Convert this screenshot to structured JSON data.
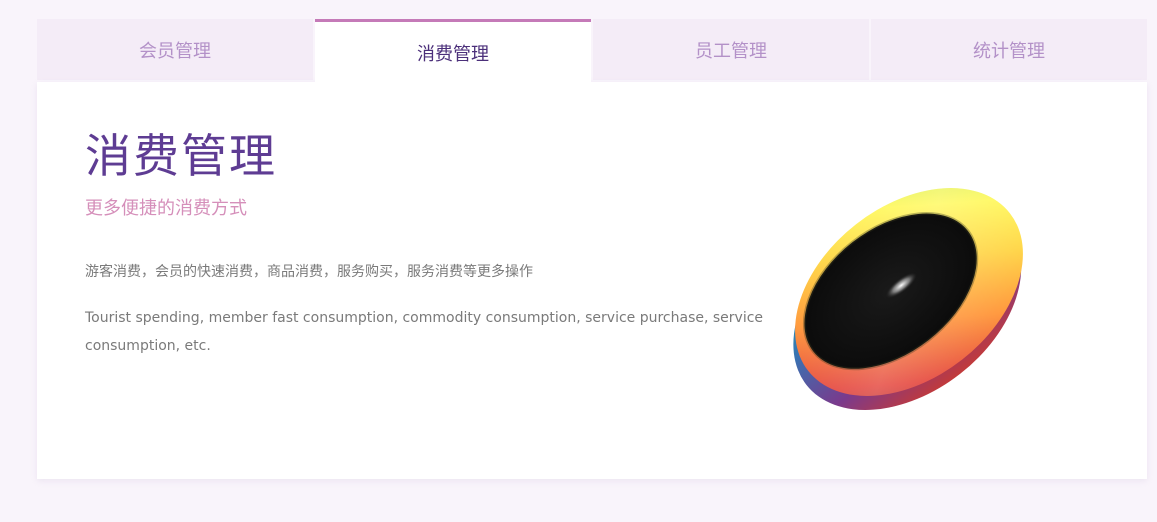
{
  "tabs": [
    {
      "label": "会员管理",
      "active": false
    },
    {
      "label": "消费管理",
      "active": true
    },
    {
      "label": "员工管理",
      "active": false
    },
    {
      "label": "统计管理",
      "active": false
    }
  ],
  "panel": {
    "title": "消费管理",
    "subtitle": "更多便捷的消费方式",
    "description_cn": "游客消费，会员的快速消费，商品消费，服务购买，服务消费等更多操作",
    "description_en": "Tourist spending, member fast consumption, commodity consumption, service purchase, service consumption, etc."
  },
  "colors": {
    "accent": "#c57ab8",
    "title": "#5e3c93",
    "subtitle": "#d58fba",
    "tab_inactive_bg": "#f4ecf7",
    "tab_inactive_text": "#b391c8"
  },
  "graphic": {
    "icon": "rainbow-ring-disc-icon"
  }
}
